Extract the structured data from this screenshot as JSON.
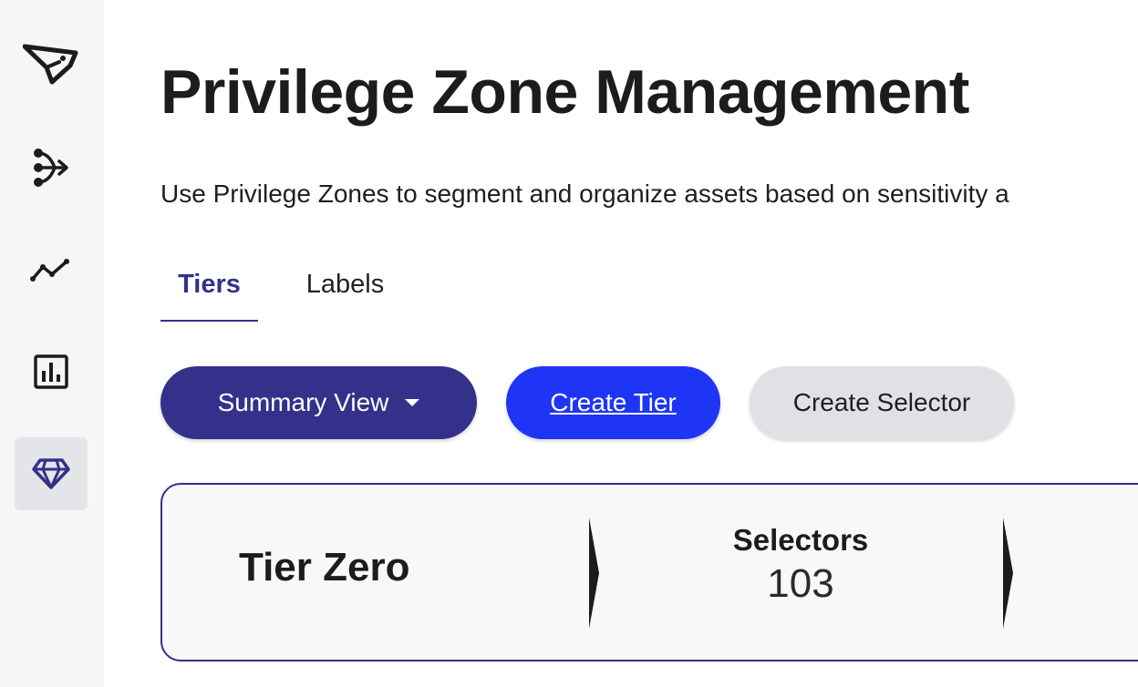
{
  "sidebar": {
    "items": [
      {
        "icon": "logo-icon"
      },
      {
        "icon": "graph-explore-icon"
      },
      {
        "icon": "trend-line-icon"
      },
      {
        "icon": "bar-chart-icon"
      },
      {
        "icon": "diamond-icon",
        "active": true
      }
    ]
  },
  "page": {
    "title": "Privilege Zone Management",
    "description": "Use Privilege Zones to segment and organize assets based on sensitivity a"
  },
  "tabs": [
    {
      "label": "Tiers",
      "active": true
    },
    {
      "label": "Labels",
      "active": false
    }
  ],
  "toolbar": {
    "summary_view_label": "Summary View",
    "create_tier_label": "Create Tier",
    "create_selector_label": "Create Selector"
  },
  "tier_card": {
    "name": "Tier Zero",
    "selectors_label": "Selectors",
    "selectors_count": "103"
  },
  "colors": {
    "primary": "#33318a",
    "accent_blue": "#1f35f5",
    "sidebar_bg": "#f6f6f6",
    "active_nav_bg": "#e4e5e8",
    "neutral_button": "#dfe1e5"
  }
}
